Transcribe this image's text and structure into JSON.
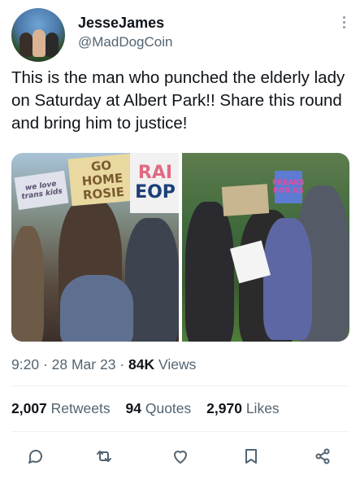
{
  "author": {
    "name": "JesseJames",
    "handle": "@MadDogCoin",
    "avatar_icon": "profile-photo"
  },
  "more_icon": "more-vertical-icon",
  "tweet": {
    "text": "This is the man who punched the elderly lady on Saturday at Albert Park!! Share this round and bring him to justice!"
  },
  "media": {
    "left_signs": {
      "sign1": "GO HOME ROSIE",
      "sign2_a": "RAI",
      "sign2_b": "EOP",
      "sign3": "we love trans kids"
    },
    "right_signs": {
      "sign4": "",
      "sign5": "FREAKS FOR US"
    }
  },
  "meta": {
    "time": "9:20",
    "date": "28 Mar 23",
    "views_count": "84K",
    "views_label": "Views",
    "sep": "·"
  },
  "stats": {
    "retweets_count": "2,007",
    "retweets_label": "Retweets",
    "quotes_count": "94",
    "quotes_label": "Quotes",
    "likes_count": "2,970",
    "likes_label": "Likes"
  },
  "actions": [
    "reply-icon",
    "retweet-icon",
    "like-icon",
    "bookmark-icon",
    "share-icon"
  ],
  "colors": {
    "text": "#0f1419",
    "secondary": "#536471",
    "divider": "#eff3f4"
  }
}
